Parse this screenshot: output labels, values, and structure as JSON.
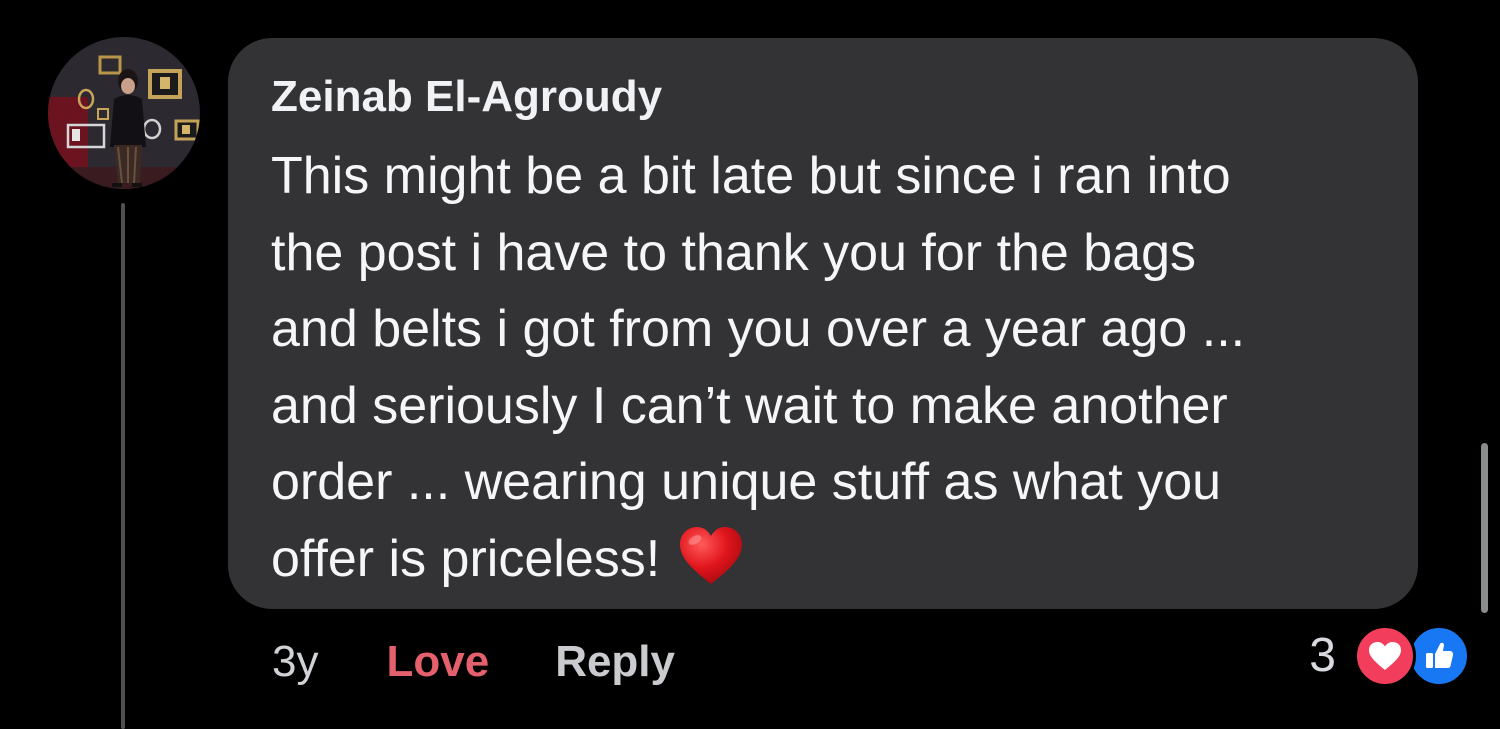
{
  "comment": {
    "author": "Zeinab El-Agroudy",
    "text_lines": [
      "This might be a bit late but since i ran into",
      "the post i have to thank you for the bags",
      "and belts i got from you over a year ago ...",
      "and seriously I can’t wait to make another",
      "order ... wearing unique stuff as what you",
      "offer is priceless!"
    ],
    "emoji": "heart-emoji",
    "avatar_icon": "profile-photo-avatar"
  },
  "actions": {
    "time": "3y",
    "love_label": "Love",
    "reply_label": "Reply"
  },
  "reactions": {
    "count": "3",
    "types": [
      "love",
      "like"
    ],
    "colors": {
      "love": "#f23e5c",
      "like": "#1877f2",
      "love_text": "#e4606d"
    }
  },
  "theme": {
    "background": "#000000",
    "bubble": "#333335",
    "thread_line": "#4e4f50"
  }
}
